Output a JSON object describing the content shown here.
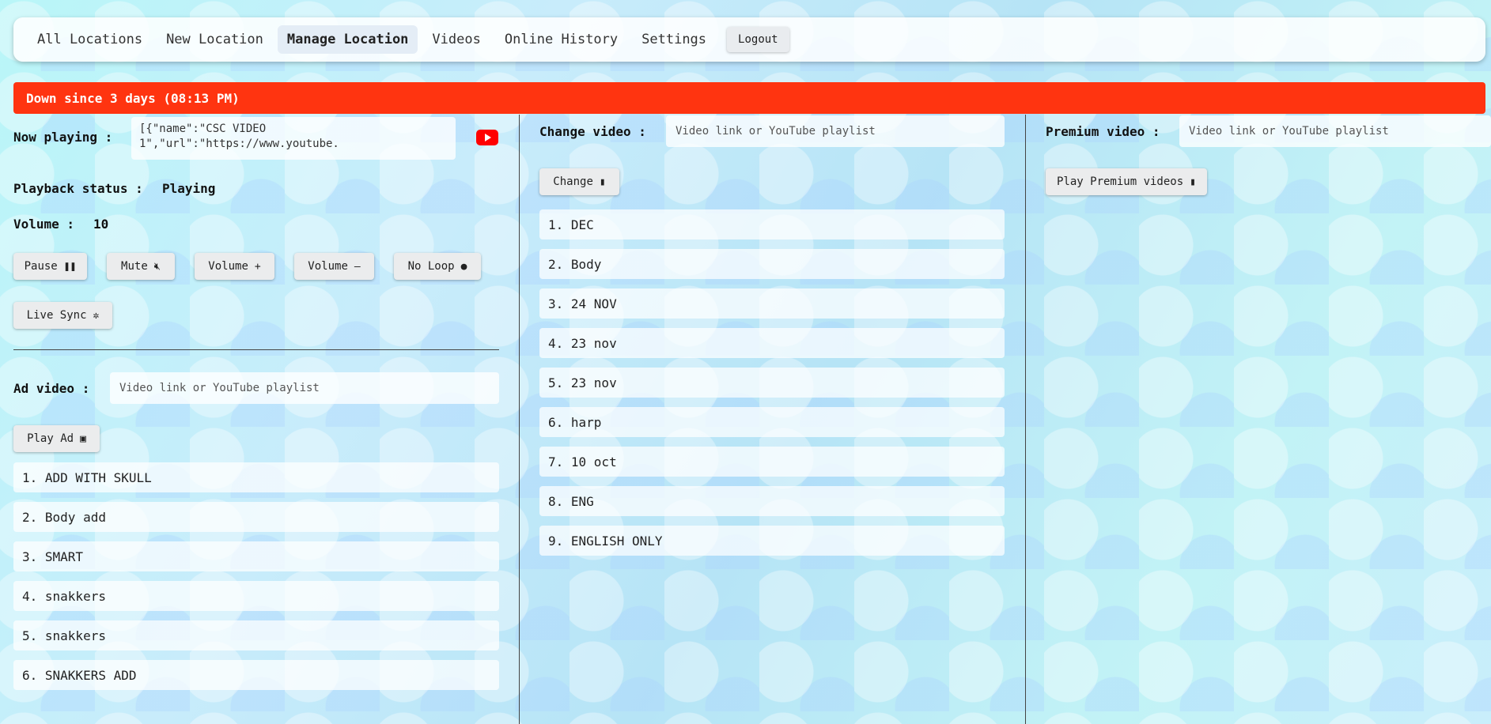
{
  "nav": {
    "items": [
      "All Locations",
      "New Location",
      "Manage Location",
      "Videos",
      "Online History",
      "Settings"
    ],
    "active": "Manage Location",
    "logout": "Logout"
  },
  "banner": {
    "text": "Down since 3 days (08:13 PM)",
    "color": "#ff3410"
  },
  "left": {
    "now_playing_label": "Now playing :",
    "now_playing_value": "[{\"name\":\"CSC VIDEO 1\",\"url\":\"https://www.youtube.",
    "playback_label": "Playback status :",
    "playback_value": "Playing",
    "volume_label": "Volume :",
    "volume_value": "10",
    "buttons": {
      "pause": "Pause",
      "mute": "Mute",
      "volume_up": "Volume",
      "volume_down": "Volume",
      "no_loop": "No Loop",
      "live_sync": "Live Sync"
    },
    "ad_label": "Ad video :",
    "ad_placeholder": "Video link or YouTube playlist",
    "play_ad": "Play Ad",
    "ad_list": [
      "1. ADD WITH SKULL",
      "2. Body add",
      "3. SMART",
      "4. snakkers",
      "5. snakkers",
      "6. SNAKKERS ADD"
    ]
  },
  "middle": {
    "change_label": "Change video :",
    "change_placeholder": "Video link or YouTube playlist",
    "change_button": "Change",
    "video_list": [
      "1. DEC",
      "2. Body",
      "3. 24 NOV",
      "4. 23 nov",
      "5. 23 nov",
      "6. harp",
      "7. 10 oct",
      "8. ENG",
      "9. ENGLISH ONLY"
    ]
  },
  "right": {
    "premium_label": "Premium video :",
    "premium_placeholder": "Video link or YouTube playlist",
    "premium_button": "Play Premium videos"
  }
}
